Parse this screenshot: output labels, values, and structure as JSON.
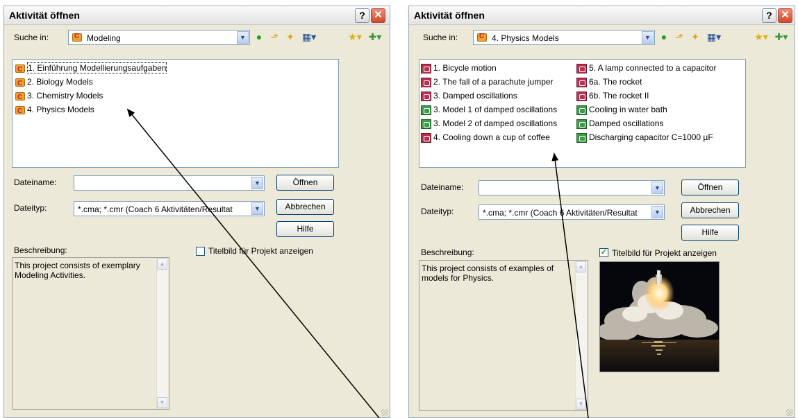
{
  "dialogs": [
    {
      "title": "Aktivität öffnen",
      "look_in_label": "Suche in:",
      "look_in_value": "Modeling",
      "items": [
        {
          "label": "1. Einführung Modellierungsaufgaben",
          "icon": "folder-icon"
        },
        {
          "label": "2. Biology Models",
          "icon": "folder-icon"
        },
        {
          "label": "3. Chemistry Models",
          "icon": "folder-icon"
        },
        {
          "label": "4. Physics Models",
          "icon": "folder-icon"
        }
      ],
      "filename_label": "Dateiname:",
      "filename_value": "",
      "filetype_label": "Dateityp:",
      "filetype_value": "*.cma; *.cmr (Coach 6 Aktivitäten/Resultat",
      "open_label": "Öffnen",
      "cancel_label": "Abbrechen",
      "help_label": "Hilfe",
      "description_label": "Beschreibung:",
      "description_text": "This project consists of exemplary Modeling Activities.",
      "show_title_image_label": "Titelbild für Projekt anzeigen",
      "show_title_image_checked": false
    },
    {
      "title": "Aktivität öffnen",
      "look_in_label": "Suche in:",
      "look_in_value": "4. Physics Models",
      "items": [
        {
          "label": "1. Bicycle motion",
          "icon": "model-icon"
        },
        {
          "label": "2. The fall of a parachute jumper",
          "icon": "model-icon"
        },
        {
          "label": "3. Damped oscillations",
          "icon": "model-icon"
        },
        {
          "label": "3. Model 1 of damped oscillations",
          "icon": "model-green-icon"
        },
        {
          "label": "3. Model 2 of damped oscillations",
          "icon": "model-green-icon"
        },
        {
          "label": "4. Cooling down a cup of coffee",
          "icon": "model-icon"
        },
        {
          "label": "5. A lamp connected to a capacitor",
          "icon": "model-icon"
        },
        {
          "label": "6a. The rocket",
          "icon": "model-icon"
        },
        {
          "label": "6b. The rocket II",
          "icon": "model-icon"
        },
        {
          "label": "Cooling in water bath",
          "icon": "model-green-icon"
        },
        {
          "label": "Damped oscillations",
          "icon": "model-green-icon"
        },
        {
          "label": "Discharging capacitor C=1000 µF",
          "icon": "model-green-icon"
        }
      ],
      "filename_label": "Dateiname:",
      "filename_value": "",
      "filetype_label": "Dateityp:",
      "filetype_value": "*.cma; *.cmr (Coach 6 Aktivitäten/Resultat",
      "open_label": "Öffnen",
      "cancel_label": "Abbrechen",
      "help_label": "Hilfe",
      "description_label": "Beschreibung:",
      "description_text": "This project consists of examples of models for Physics.",
      "show_title_image_label": "Titelbild für Projekt anzeigen",
      "show_title_image_checked": true,
      "title_image": "space-shuttle-launch-photo"
    }
  ],
  "colors": {
    "dialog_bg": "#ece9d8",
    "accent": "#003c74",
    "close": "#d44a2a"
  },
  "titlebar_icons": [
    "help-icon",
    "close-icon"
  ],
  "toolbar_icons": [
    "back-icon",
    "up-folder-icon",
    "new-folder-icon",
    "view-menu-icon",
    "favorites-icon",
    "add-favorite-icon"
  ]
}
